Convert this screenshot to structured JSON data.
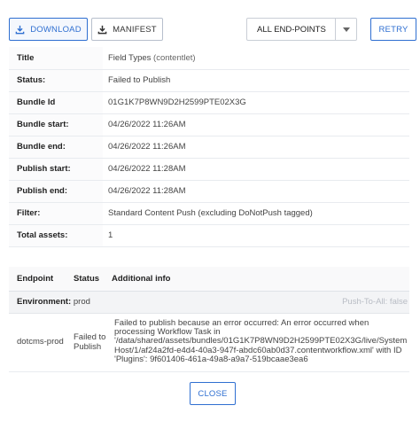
{
  "toolbar": {
    "download_label": "DOWNLOAD",
    "manifest_label": "MANIFEST",
    "endpoint_select_value": "ALL END-POINTS",
    "retry_label": "RETRY"
  },
  "details": [
    {
      "key": "Title",
      "value": "Field Types",
      "tag": "(contentlet)"
    },
    {
      "key": "Status:",
      "value": "Failed to Publish"
    },
    {
      "key": "Bundle Id",
      "value": "01G1K7P8WN9D2H2599PTE02X3G"
    },
    {
      "key": "Bundle start:",
      "value": "04/26/2022 11:26AM"
    },
    {
      "key": "Bundle end:",
      "value": "04/26/2022 11:26AM"
    },
    {
      "key": "Publish start:",
      "value": "04/26/2022 11:28AM"
    },
    {
      "key": "Publish end:",
      "value": "04/26/2022 11:28AM"
    },
    {
      "key": "Filter:",
      "value": "Standard Content Push (excluding DoNotPush tagged)"
    },
    {
      "key": "Total assets:",
      "value": "1"
    }
  ],
  "endpoints": {
    "headers": {
      "endpoint": "Endpoint",
      "status": "Status",
      "info": "Additional info"
    },
    "environment_label": "Environment:",
    "environment_name": "prod",
    "push_to_all": "Push-To-All: false",
    "rows": [
      {
        "endpoint": "dotcms-prod",
        "status": "Failed to Publish",
        "info": "Failed to publish because an error occurred: An error occurred when processing Workflow Task in '/data/shared/assets/bundles/01G1K7P8WN9D2H2599PTE02X3G/live/System Host/1/af24a2fd-e4d4-40a3-947f-abdc60ab0d37.contentworkflow.xml' with ID 'Plugins': 9f601406-461a-49a8-a9a7-519bcaae3ea6"
      }
    ]
  },
  "footer": {
    "close_label": "CLOSE"
  },
  "colors": {
    "accent": "#2f6fd1",
    "border": "#e8ebef",
    "header_bg": "#f9f9fa"
  }
}
